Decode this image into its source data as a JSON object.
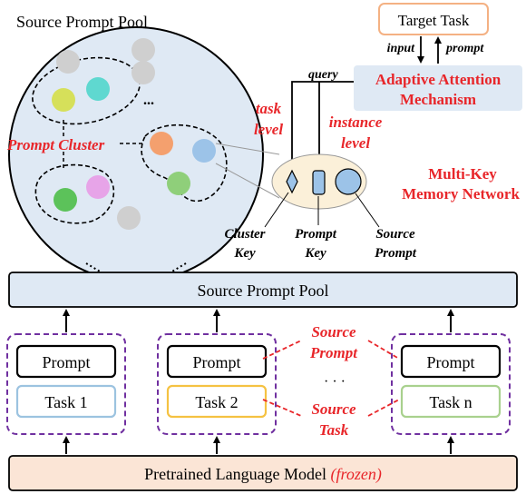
{
  "pool_title": "Source Prompt Pool",
  "pool_bar_label": "Source Prompt Pool",
  "ellipsis": "...",
  "prompt_cluster_label": "Prompt Cluster",
  "target_task": "Target Task",
  "input_label": "input",
  "prompt_label": "prompt",
  "query_label": "query",
  "attention": {
    "line1": "Adaptive Attention",
    "line2": "Mechanism"
  },
  "task_level": {
    "line1": "task",
    "line2": "level"
  },
  "instance_level": {
    "line1": "instance",
    "line2": "level"
  },
  "memory_network": {
    "line1": "Multi-Key",
    "line2": "Memory Network"
  },
  "keys": [
    {
      "line1": "Cluster",
      "line2": "Key"
    },
    {
      "line1": "Prompt",
      "line2": "Key"
    },
    {
      "line1": "Source",
      "line2": "Prompt"
    }
  ],
  "tasks": [
    {
      "prompt": "Prompt",
      "task": "Task 1",
      "color": "#9cc3e0"
    },
    {
      "prompt": "Prompt",
      "task": "Task 2",
      "color": "#f5c242"
    },
    {
      "prompt": "Prompt",
      "task": "Task n",
      "color": "#a9d18e"
    }
  ],
  "middle_dots": "· · ·",
  "source_prompt_annot": {
    "line1": "Source",
    "line2": "Prompt"
  },
  "source_task_annot": {
    "line1": "Source",
    "line2": "Task"
  },
  "plm": {
    "text": "Pretrained Language Model ",
    "frozen": "(frozen)"
  },
  "colors": {
    "accent_red": "#e8262a",
    "pool_fill": "#dfe9f4",
    "plm_fill": "#fbe5d6",
    "target_border": "#f4b183",
    "dashed_purple": "#7030a0",
    "memory_fill": "#fbf0d9"
  },
  "pool_dots": [
    {
      "name": "dot-yellowgreen",
      "color": "#d6e05a"
    },
    {
      "name": "dot-cyan",
      "color": "#5fd8d0"
    },
    {
      "name": "dot-orange",
      "color": "#f4a06e"
    },
    {
      "name": "dot-blue",
      "color": "#9cc3e8"
    },
    {
      "name": "dot-green-light",
      "color": "#8fcf7a"
    },
    {
      "name": "dot-green",
      "color": "#5cc25a"
    },
    {
      "name": "dot-pink",
      "color": "#e7a4e8"
    },
    {
      "name": "dot-gray-1",
      "color": "#cfcfcf"
    },
    {
      "name": "dot-gray-2",
      "color": "#cfcfcf"
    },
    {
      "name": "dot-gray-3",
      "color": "#cfcfcf"
    },
    {
      "name": "dot-gray-4",
      "color": "#cfcfcf"
    }
  ]
}
